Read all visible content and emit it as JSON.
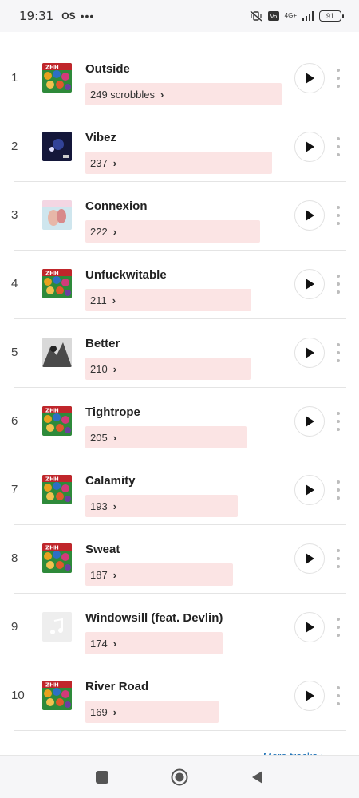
{
  "status_bar": {
    "time": "19:31",
    "carrier_badge": "OS",
    "network": "4G+",
    "battery": "91"
  },
  "tracks": [
    {
      "rank": "1",
      "title": "Outside",
      "scrobbles": "249 scrobbles",
      "fill": 1.0,
      "art": "collage"
    },
    {
      "rank": "2",
      "title": "Vibez",
      "scrobbles": "237",
      "fill": 0.952,
      "art": "dark"
    },
    {
      "rank": "3",
      "title": "Connexion",
      "scrobbles": "222",
      "fill": 0.892,
      "art": "light"
    },
    {
      "rank": "4",
      "title": "Unfuckwitable",
      "scrobbles": "211",
      "fill": 0.847,
      "art": "collage"
    },
    {
      "rank": "5",
      "title": "Better",
      "scrobbles": "210",
      "fill": 0.843,
      "art": "bw"
    },
    {
      "rank": "6",
      "title": "Tightrope",
      "scrobbles": "205",
      "fill": 0.823,
      "art": "collage"
    },
    {
      "rank": "7",
      "title": "Calamity",
      "scrobbles": "193",
      "fill": 0.775,
      "art": "collage"
    },
    {
      "rank": "8",
      "title": "Sweat",
      "scrobbles": "187",
      "fill": 0.751,
      "art": "collage"
    },
    {
      "rank": "9",
      "title": "Windowsill (feat. Devlin)",
      "scrobbles": "174",
      "fill": 0.699,
      "art": "placeholder"
    },
    {
      "rank": "10",
      "title": "River Road",
      "scrobbles": "169",
      "fill": 0.679,
      "art": "collage"
    }
  ],
  "more_tracks_label": "More tracks",
  "colors": {
    "scrobble_bar": "#fbe4e4",
    "link": "#1a6fb5"
  },
  "icons": {
    "play": "play-icon",
    "more": "kebab-menu-icon",
    "nav_recents": "square-icon",
    "nav_home": "circle-icon",
    "nav_back": "triangle-back-icon"
  }
}
